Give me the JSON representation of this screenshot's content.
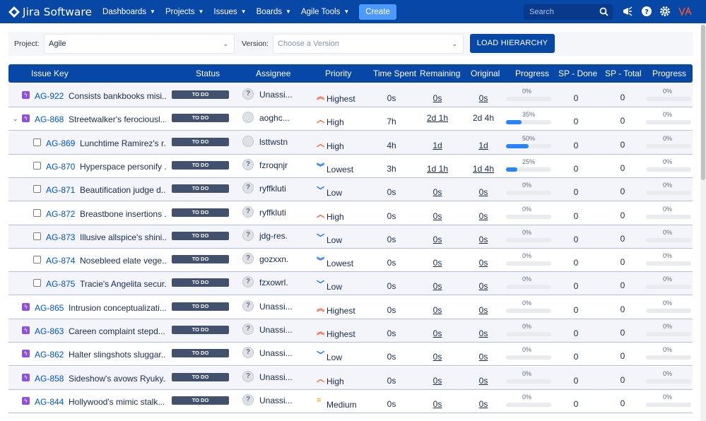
{
  "nav": {
    "logo_text": "Jira Software",
    "items": [
      {
        "label": "Dashboards"
      },
      {
        "label": "Projects"
      },
      {
        "label": "Issues"
      },
      {
        "label": "Boards"
      },
      {
        "label": "Agile Tools"
      }
    ],
    "create_label": "Create",
    "search_placeholder": "Search"
  },
  "filters": {
    "project_label": "Project:",
    "project_value": "Agile",
    "version_label": "Version:",
    "version_placeholder": "Choose a Version",
    "load_button": "LOAD HIERARCHY"
  },
  "table": {
    "headers": [
      "Issue Key",
      "Status",
      "Assignee",
      "Priority",
      "Time Spent",
      "Remaining",
      "Original",
      "Progress",
      "SP - Done",
      "SP - Total",
      "Progress"
    ],
    "rows": [
      {
        "type": "epic",
        "key": "AG-922",
        "summary": "Consists bankbooks misi...",
        "status": "TO DO",
        "avatar": "unknown",
        "assignee": "Unassi...",
        "priority": "Highest",
        "spent": "0s",
        "remaining": "0s",
        "original": "0s",
        "progress": "0%",
        "sp_done": "0",
        "sp_total": "0",
        "sp_progress": "0%"
      },
      {
        "type": "epic",
        "key": "AG-868",
        "summary": "Streetwalker's ferociousl...",
        "status": "TO DO",
        "avatar": "user",
        "assignee": "aoghc...",
        "priority": "High",
        "spent": "7h",
        "remaining": "2d 1h",
        "original": "2d 4h",
        "progress": "35%",
        "sp_done": "0",
        "sp_total": "0",
        "sp_progress": "0%",
        "expandable": true
      },
      {
        "type": "story",
        "key": "AG-869",
        "summary": "Lunchtime Ramirez's r...",
        "status": "TO DO",
        "avatar": "user",
        "assignee": "lsttwstn",
        "priority": "High",
        "spent": "4h",
        "remaining": "1d",
        "original": "1d",
        "progress": "50%",
        "sp_done": "0",
        "sp_total": "0",
        "sp_progress": "0%"
      },
      {
        "type": "story",
        "key": "AG-870",
        "summary": "Hyperspace personify ...",
        "status": "TO DO",
        "avatar": "unknown",
        "assignee": "fzroqnjr",
        "priority": "Lowest",
        "spent": "3h",
        "remaining": "1d 1h",
        "original": "1d 4h",
        "progress": "25%",
        "sp_done": "0",
        "sp_total": "0",
        "sp_progress": "0%"
      },
      {
        "type": "story",
        "key": "AG-871",
        "summary": "Beautification judge d...",
        "status": "TO DO",
        "avatar": "unknown",
        "assignee": "ryffkluti",
        "priority": "Low",
        "spent": "0s",
        "remaining": "0s",
        "original": "0s",
        "progress": "0%",
        "sp_done": "0",
        "sp_total": "0",
        "sp_progress": "0%"
      },
      {
        "type": "story",
        "key": "AG-872",
        "summary": "Breastbone insertions ...",
        "status": "TO DO",
        "avatar": "unknown",
        "assignee": "ryffkluti",
        "priority": "High",
        "spent": "0s",
        "remaining": "0s",
        "original": "0s",
        "progress": "0%",
        "sp_done": "0",
        "sp_total": "0",
        "sp_progress": "0%"
      },
      {
        "type": "story",
        "key": "AG-873",
        "summary": "Illusive allspice's shini...",
        "status": "TO DO",
        "avatar": "unknown",
        "assignee": "jdg-res.",
        "priority": "Low",
        "spent": "0s",
        "remaining": "0s",
        "original": "0s",
        "progress": "0%",
        "sp_done": "0",
        "sp_total": "0",
        "sp_progress": "0%"
      },
      {
        "type": "story",
        "key": "AG-874",
        "summary": "Nosebleed elate vege...",
        "status": "TO DO",
        "avatar": "unknown",
        "assignee": "gozxxn.",
        "priority": "Lowest",
        "spent": "0s",
        "remaining": "0s",
        "original": "0s",
        "progress": "0%",
        "sp_done": "0",
        "sp_total": "0",
        "sp_progress": "0%"
      },
      {
        "type": "story",
        "key": "AG-875",
        "summary": "Tracie's Angelita secur...",
        "status": "TO DO",
        "avatar": "unknown",
        "assignee": "fzxowrl.",
        "priority": "Low",
        "spent": "0s",
        "remaining": "0s",
        "original": "0s",
        "progress": "0%",
        "sp_done": "0",
        "sp_total": "0",
        "sp_progress": "0%"
      },
      {
        "type": "epic",
        "key": "AG-865",
        "summary": "Intrusion conceptualizati...",
        "status": "TO DO",
        "avatar": "unknown",
        "assignee": "Unassi...",
        "priority": "Highest",
        "spent": "0s",
        "remaining": "0s",
        "original": "0s",
        "progress": "0%",
        "sp_done": "0",
        "sp_total": "0",
        "sp_progress": "0%"
      },
      {
        "type": "epic",
        "key": "AG-863",
        "summary": "Careen complaint stepd...",
        "status": "TO DO",
        "avatar": "unknown",
        "assignee": "Unassi...",
        "priority": "Highest",
        "spent": "0s",
        "remaining": "0s",
        "original": "0s",
        "progress": "0%",
        "sp_done": "0",
        "sp_total": "0",
        "sp_progress": "0%"
      },
      {
        "type": "epic",
        "key": "AG-862",
        "summary": "Halter slingshots sluggar...",
        "status": "TO DO",
        "avatar": "unknown",
        "assignee": "Unassi...",
        "priority": "Low",
        "spent": "0s",
        "remaining": "0s",
        "original": "0s",
        "progress": "0%",
        "sp_done": "0",
        "sp_total": "0",
        "sp_progress": "0%"
      },
      {
        "type": "epic",
        "key": "AG-858",
        "summary": "Sideshow's avows Ryuky...",
        "status": "TO DO",
        "avatar": "unknown",
        "assignee": "Unassi...",
        "priority": "High",
        "spent": "0s",
        "remaining": "0s",
        "original": "0s",
        "progress": "0%",
        "sp_done": "0",
        "sp_total": "0",
        "sp_progress": "0%"
      },
      {
        "type": "epic",
        "key": "AG-844",
        "summary": "Hollywood's mimic stalk...",
        "status": "TO DO",
        "avatar": "unknown",
        "assignee": "Unassi...",
        "priority": "Medium",
        "spent": "0s",
        "remaining": "0s",
        "original": "0s",
        "progress": "0%",
        "sp_done": "0",
        "sp_total": "0",
        "sp_progress": "0%"
      }
    ]
  },
  "colors": {
    "brand": "#0747a6",
    "accent": "#4c9aff",
    "progress": "#2684ff",
    "priority_high": "#ff5630",
    "priority_low": "#0065ff",
    "priority_medium": "#ffab00",
    "epic": "#904ee2"
  }
}
